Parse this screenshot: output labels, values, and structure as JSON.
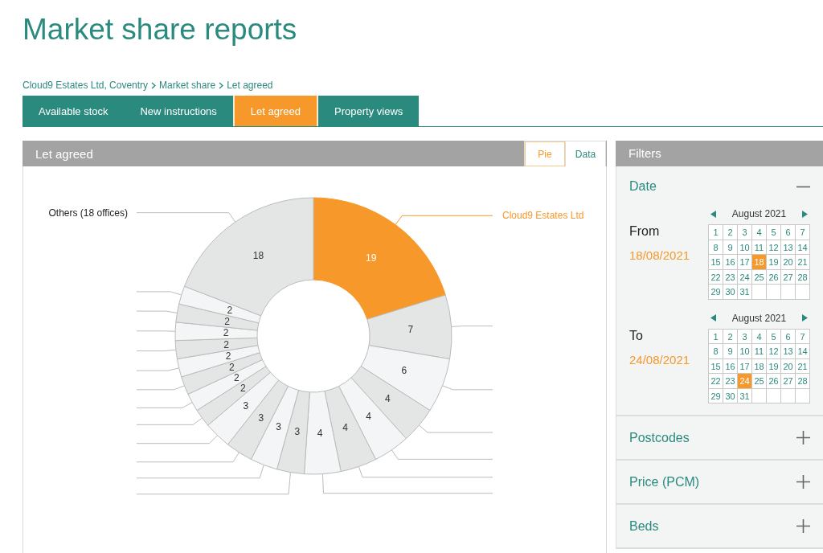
{
  "page_title": "Market share reports",
  "breadcrumb": [
    "Cloud9 Estates Ltd, Coventry",
    "Market share",
    "Let agreed"
  ],
  "tabs": [
    {
      "label": "Available stock",
      "selected": false
    },
    {
      "label": "New instructions",
      "selected": false
    },
    {
      "label": "Let agreed",
      "selected": true
    },
    {
      "label": "Property views",
      "selected": false
    }
  ],
  "report_panel": {
    "title": "Let agreed",
    "view_toggle": [
      {
        "label": "Pie",
        "selected": true
      },
      {
        "label": "Data",
        "selected": false
      }
    ],
    "chart_data": {
      "type": "donut",
      "data_labels": true,
      "categories": [
        "Cloud9 Estates Ltd",
        null,
        null,
        null,
        null,
        null,
        null,
        null,
        null,
        null,
        null,
        null,
        null,
        null,
        null,
        null,
        null,
        null,
        null,
        "Others (18 offices)"
      ],
      "values": [
        19,
        7,
        6,
        4,
        4,
        4,
        4,
        3,
        3,
        3,
        3,
        2,
        2,
        2,
        2,
        2,
        2,
        2,
        2,
        18
      ]
    }
  },
  "filters": {
    "title": "Filters",
    "sections": [
      {
        "label": "Date",
        "expanded": true,
        "calendars": [
          {
            "label": "From",
            "date": "18/08/2021",
            "month": "August 2021",
            "days": [
              {
                "day": "1",
                "selected": false
              },
              {
                "day": "2",
                "selected": false
              },
              {
                "day": "3",
                "selected": false
              },
              {
                "day": "4",
                "selected": false
              },
              {
                "day": "5",
                "selected": false
              },
              {
                "day": "6",
                "selected": false
              },
              {
                "day": "7",
                "selected": false
              },
              {
                "day": "8",
                "selected": false
              },
              {
                "day": "9",
                "selected": false
              },
              {
                "day": "10",
                "selected": false
              },
              {
                "day": "11",
                "selected": false
              },
              {
                "day": "12",
                "selected": false
              },
              {
                "day": "13",
                "selected": false
              },
              {
                "day": "14",
                "selected": false
              },
              {
                "day": "15",
                "selected": false
              },
              {
                "day": "16",
                "selected": false
              },
              {
                "day": "17",
                "selected": false
              },
              {
                "day": "18",
                "selected": true
              },
              {
                "day": "19",
                "selected": false
              },
              {
                "day": "20",
                "selected": false
              },
              {
                "day": "21",
                "selected": false
              },
              {
                "day": "22",
                "selected": false
              },
              {
                "day": "23",
                "selected": false
              },
              {
                "day": "24",
                "selected": false
              },
              {
                "day": "25",
                "selected": false
              },
              {
                "day": "26",
                "selected": false
              },
              {
                "day": "27",
                "selected": false
              },
              {
                "day": "28",
                "selected": false
              },
              {
                "day": "29",
                "selected": false
              },
              {
                "day": "30",
                "selected": false
              },
              {
                "day": "31",
                "selected": false
              }
            ]
          },
          {
            "label": "To",
            "date": "24/08/2021",
            "month": "August 2021",
            "days": [
              {
                "day": "1",
                "selected": false
              },
              {
                "day": "2",
                "selected": false
              },
              {
                "day": "3",
                "selected": false
              },
              {
                "day": "4",
                "selected": false
              },
              {
                "day": "5",
                "selected": false
              },
              {
                "day": "6",
                "selected": false
              },
              {
                "day": "7",
                "selected": false
              },
              {
                "day": "8",
                "selected": false
              },
              {
                "day": "9",
                "selected": false
              },
              {
                "day": "10",
                "selected": false
              },
              {
                "day": "11",
                "selected": false
              },
              {
                "day": "12",
                "selected": false
              },
              {
                "day": "13",
                "selected": false
              },
              {
                "day": "14",
                "selected": false
              },
              {
                "day": "15",
                "selected": false
              },
              {
                "day": "16",
                "selected": false
              },
              {
                "day": "17",
                "selected": false
              },
              {
                "day": "18",
                "selected": false
              },
              {
                "day": "19",
                "selected": false
              },
              {
                "day": "20",
                "selected": false
              },
              {
                "day": "21",
                "selected": false
              },
              {
                "day": "22",
                "selected": false
              },
              {
                "day": "23",
                "selected": false
              },
              {
                "day": "24",
                "selected": true
              },
              {
                "day": "25",
                "selected": false
              },
              {
                "day": "26",
                "selected": false
              },
              {
                "day": "27",
                "selected": false
              },
              {
                "day": "28",
                "selected": false
              },
              {
                "day": "29",
                "selected": false
              },
              {
                "day": "30",
                "selected": false
              },
              {
                "day": "31",
                "selected": false
              }
            ]
          }
        ]
      },
      {
        "label": "Postcodes",
        "expanded": false
      },
      {
        "label": "Price (PCM)",
        "expanded": false
      },
      {
        "label": "Beds",
        "expanded": false
      }
    ]
  }
}
